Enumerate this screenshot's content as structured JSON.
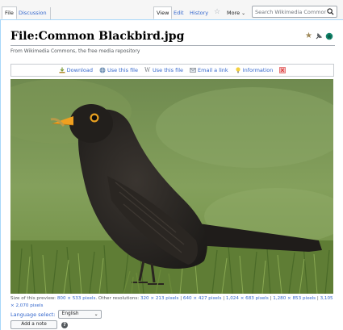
{
  "tabs": {
    "file": "File",
    "discussion": "Discussion",
    "view": "View",
    "edit": "Edit",
    "history": "History",
    "more": "More"
  },
  "search": {
    "placeholder": "Search Wikimedia Commons"
  },
  "page": {
    "title": "File:Common Blackbird.jpg",
    "subtitle": "From Wikimedia Commons, the free media repository"
  },
  "toolbar": {
    "download": "Download",
    "use_file_1": "Use this file",
    "use_file_2": "Use this file",
    "email_link": "Email a link",
    "information": "Information"
  },
  "preview": {
    "size_prefix": "Size of this preview:",
    "size_value": "800 × 533 pixels",
    "other_label": ". Other resolutions:",
    "res_1": "320 × 213 pixels",
    "res_2": "640 × 427 pixels",
    "res_3": "1,024 × 683 pixels",
    "res_4": "1,280 × 853 pixels",
    "res_5": "3,105 × 2,070 pixels",
    "sep": "|"
  },
  "language": {
    "label": "Language select:",
    "selected": "English"
  },
  "note": {
    "button": "Add a note"
  },
  "colors": {
    "link": "#3366cc",
    "border": "#a2a9b1",
    "tab_border": "#c8ccd1"
  }
}
